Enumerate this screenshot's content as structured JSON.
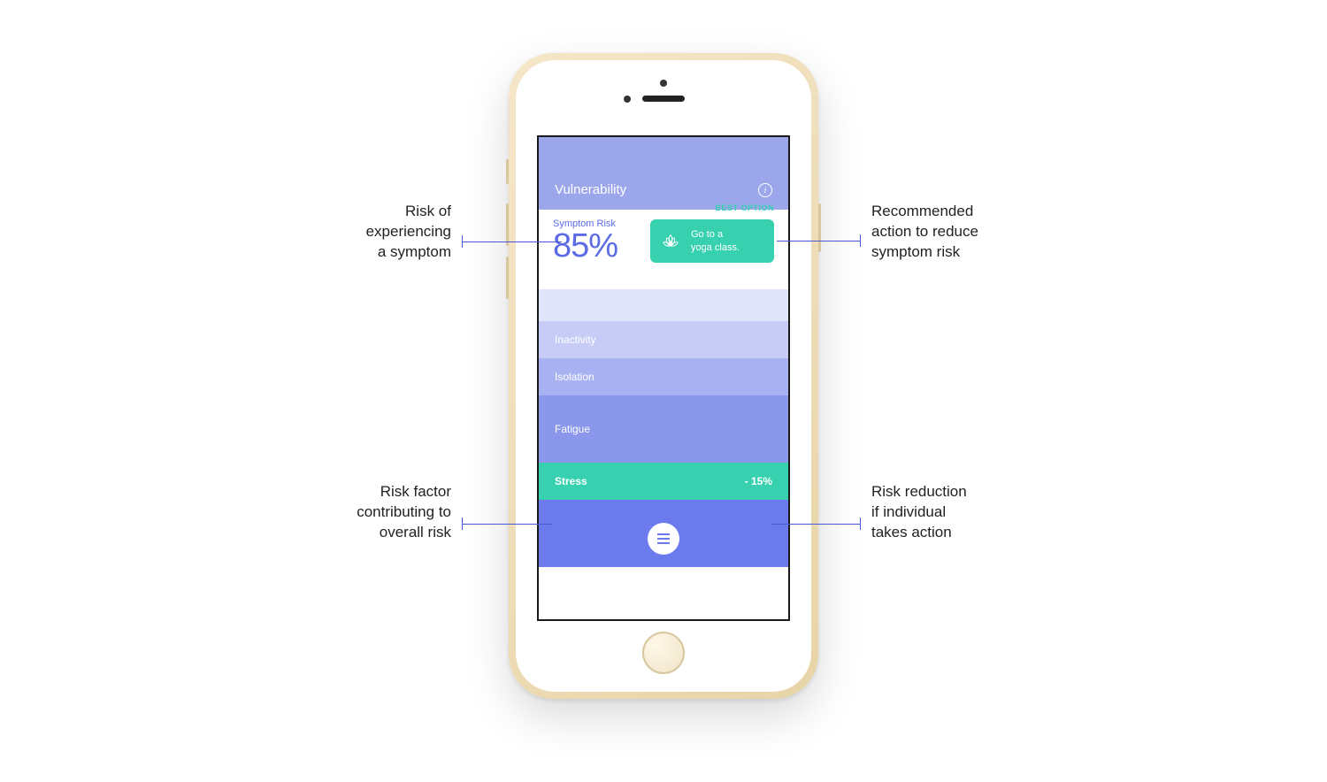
{
  "app": {
    "header_title": "Vulnerability",
    "risk_label": "Symptom Risk",
    "risk_value": "85%",
    "best_option_label": "BEST OPTION",
    "action_text": "Go to a\nyoga class.",
    "factors": {
      "f1_label": "Inactivity",
      "f2_label": "Isolation",
      "f3_label": "Fatigue",
      "f4_label": "Stress",
      "f4_reduction": "- 15%"
    }
  },
  "callouts": {
    "top_left": "Risk of\nexperiencing\na symptom",
    "top_right": "Recommended\naction to reduce\nsymptom risk",
    "bottom_left": "Risk factor\ncontributing to\noverall risk",
    "bottom_right": "Risk reduction\nif individual\ntakes action"
  },
  "colors": {
    "accent_purple": "#6b7aec",
    "accent_teal": "#38d1b0",
    "line_blue": "#4757d6"
  },
  "chart_data": {
    "type": "bar",
    "title": "Vulnerability — Symptom Risk",
    "categories": [
      "(unlabeled)",
      "Inactivity",
      "Isolation",
      "Fatigue",
      "Stress"
    ],
    "values": [
      36,
      42,
      42,
      76,
      42
    ],
    "ylabel": "relative bar height (px in screenshot)",
    "xlabel": "Risk factor",
    "highlighted_category": "Stress",
    "highlighted_reduction_pct": -15,
    "overall_risk_pct": 85,
    "recommended_action": "Go to a yoga class."
  }
}
